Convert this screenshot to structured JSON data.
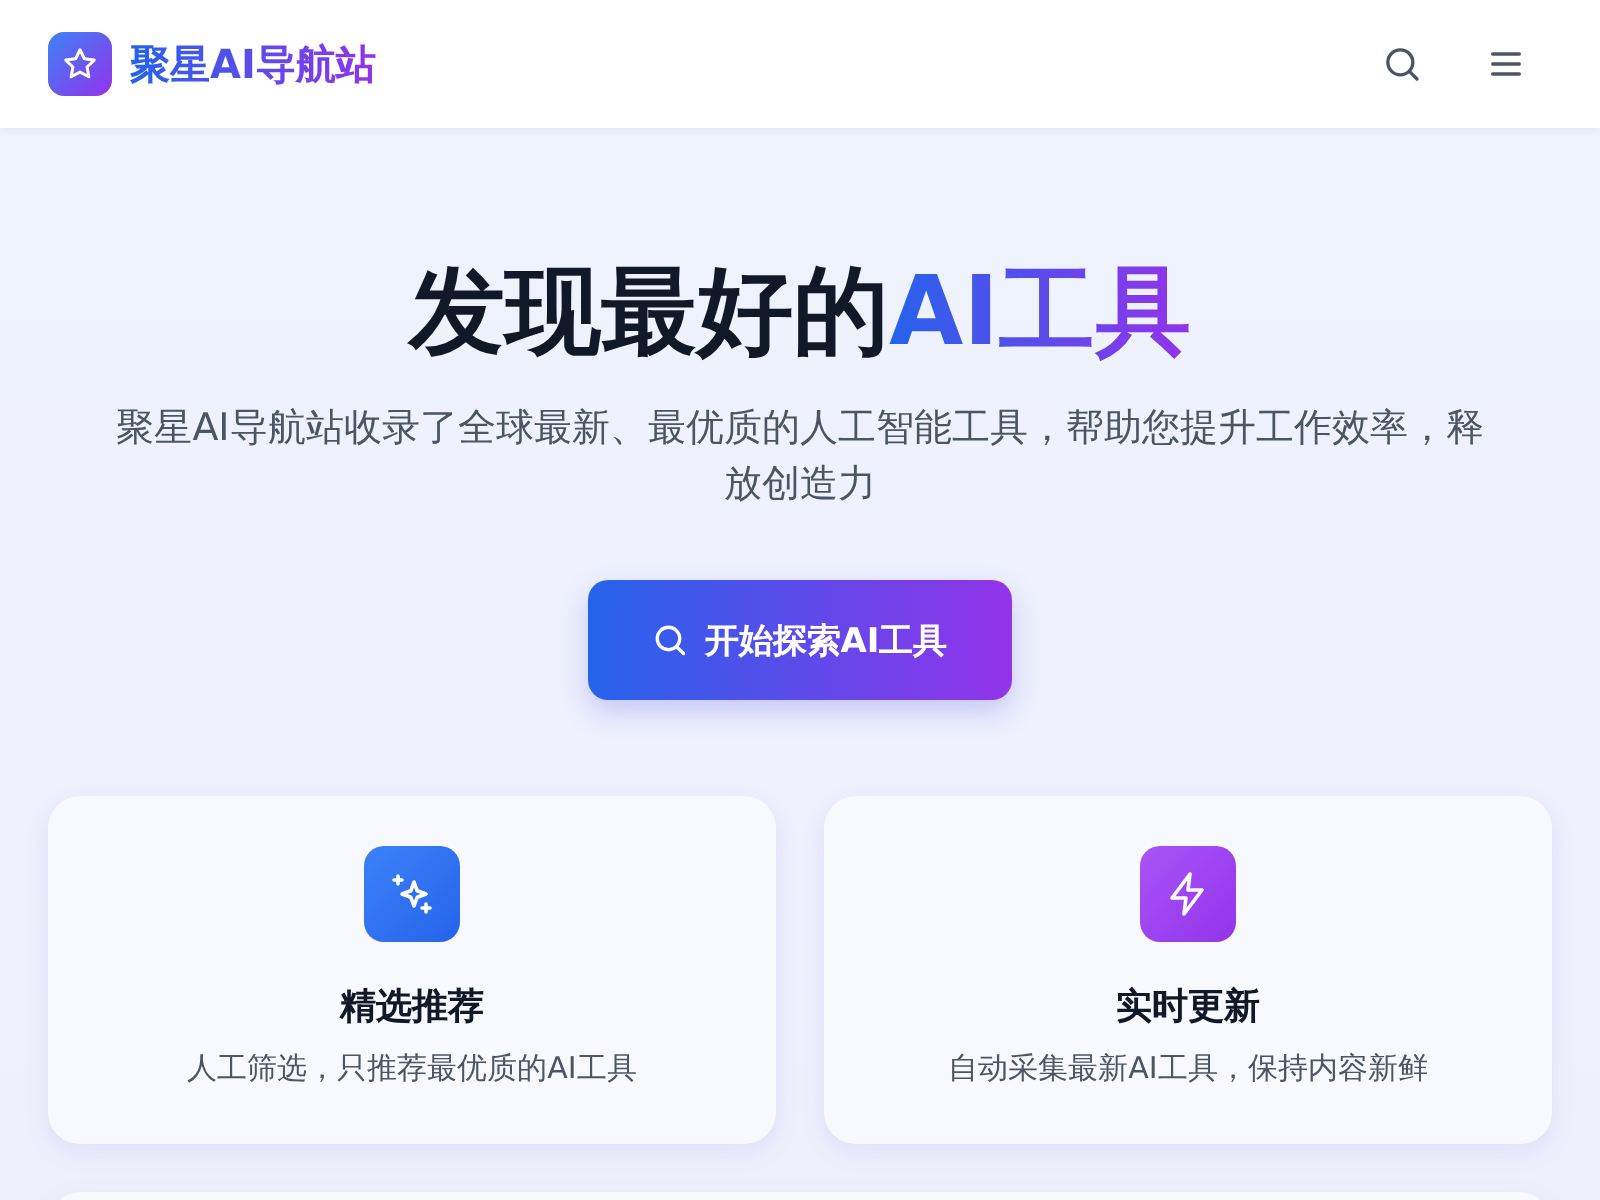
{
  "header": {
    "logo_text": "聚星AI导航站"
  },
  "hero": {
    "title_lead": "发现最好的",
    "title_highlight": "AI工具",
    "subtitle": "聚星AI导航站收录了全球最新、最优质的人工智能工具，帮助您提升工作效率，释放创造力",
    "button": "开始探索AI工具"
  },
  "features": [
    {
      "kind": "sparkles",
      "title": "精选推荐",
      "description": "人工筛选，只推荐最优质的AI工具"
    },
    {
      "kind": "bolt",
      "title": "实时更新",
      "description": "自动采集最新AI工具，保持内容新鲜"
    }
  ]
}
